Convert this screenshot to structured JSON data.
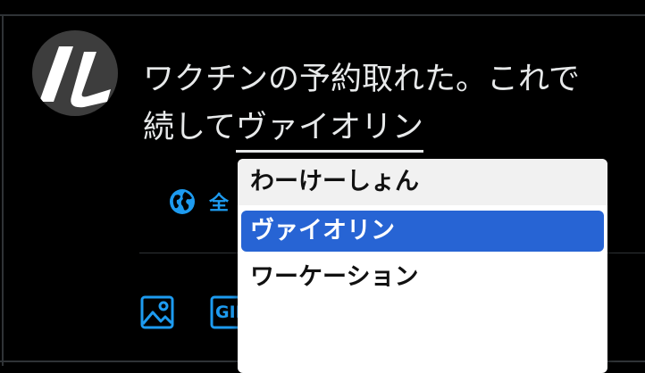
{
  "compose": {
    "line1": "ワクチンの予約取れた。これで",
    "line2_prefix": "続して",
    "composing_text": "ヴァイオリン"
  },
  "audience": {
    "label": "全",
    "icon": "globe-icon"
  },
  "toolbar": {
    "image_icon": "image-icon",
    "gif_label": "GIF"
  },
  "ime_candidates": {
    "items": [
      "わーけーしょん",
      "ヴァイオリン",
      "ワーケーション"
    ],
    "selected_index": 1
  },
  "colors": {
    "background": "#000000",
    "accent": "#1d9bf0",
    "selection": "#2764d4",
    "text": "#e7e9ea"
  }
}
